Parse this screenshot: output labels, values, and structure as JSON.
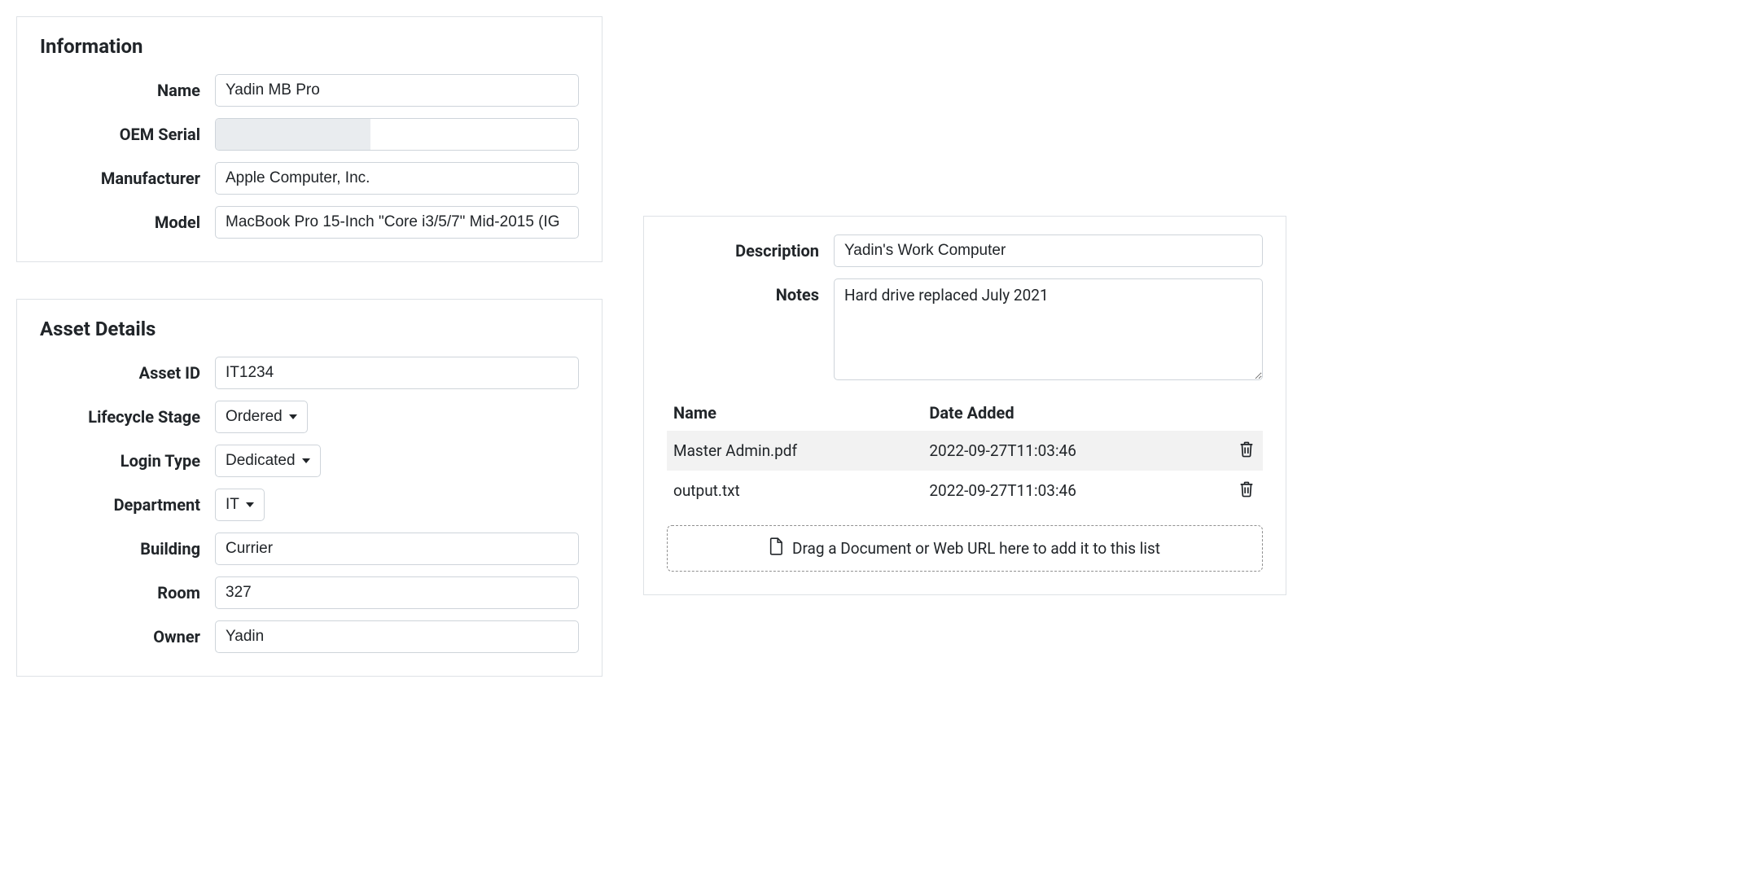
{
  "information": {
    "title": "Information",
    "name_label": "Name",
    "name_value": "Yadin MB Pro",
    "oem_label": "OEM Serial",
    "oem_value": "",
    "manufacturer_label": "Manufacturer",
    "manufacturer_value": "Apple Computer, Inc.",
    "model_label": "Model",
    "model_value": "MacBook Pro 15-Inch \"Core i3/5/7\" Mid-2015 (IG"
  },
  "asset_details": {
    "title": "Asset Details",
    "asset_id_label": "Asset ID",
    "asset_id_value": "IT1234",
    "lifecycle_label": "Lifecycle Stage",
    "lifecycle_value": "Ordered",
    "login_type_label": "Login Type",
    "login_type_value": "Dedicated",
    "department_label": "Department",
    "department_value": "IT",
    "building_label": "Building",
    "building_value": "Currier",
    "room_label": "Room",
    "room_value": "327",
    "owner_label": "Owner",
    "owner_value": "Yadin"
  },
  "right_panel": {
    "description_label": "Description",
    "description_value": "Yadin's Work Computer",
    "notes_label": "Notes",
    "notes_value": "Hard drive replaced July 2021",
    "table_headers": {
      "name": "Name",
      "date_added": "Date Added"
    },
    "rows": [
      {
        "name": "Master Admin.pdf",
        "date": "2022-09-27T11:03:46"
      },
      {
        "name": "output.txt",
        "date": "2022-09-27T11:03:46"
      }
    ],
    "dropzone_text": "Drag a Document or Web URL here to add it to this list"
  }
}
